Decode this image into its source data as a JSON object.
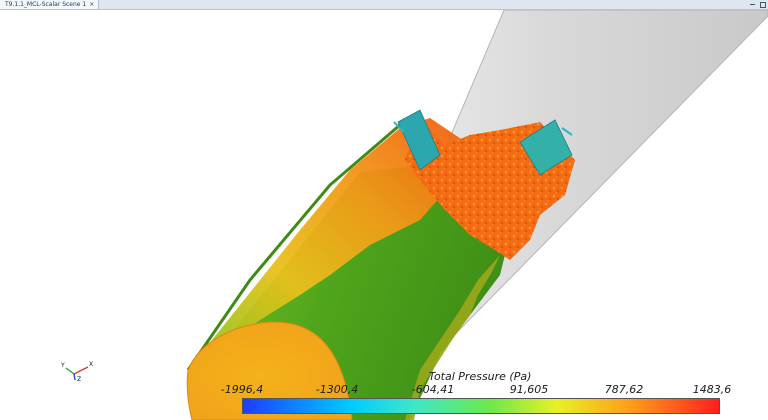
{
  "window": {
    "tab_title": "T9.1.1_MCL-Scalar Scene 1",
    "tab_close": "×"
  },
  "scene": {
    "name": "3d-scalar-scene"
  },
  "axis_triad": {
    "x": "X",
    "y": "Y",
    "z": "Z"
  },
  "legend": {
    "title": "Total Pressure (Pa)",
    "ticks": [
      "-1996,4",
      "-1300,4",
      "-604,41",
      "91,605",
      "787,62",
      "1483,6"
    ]
  },
  "colors": {
    "pipe_shell": "#e4e4e4",
    "surface_green": "#4caf1a",
    "surface_orange": "#f56a12",
    "surface_yellow": "#f2b21c",
    "inlet_teal": "#2ba7ad"
  }
}
